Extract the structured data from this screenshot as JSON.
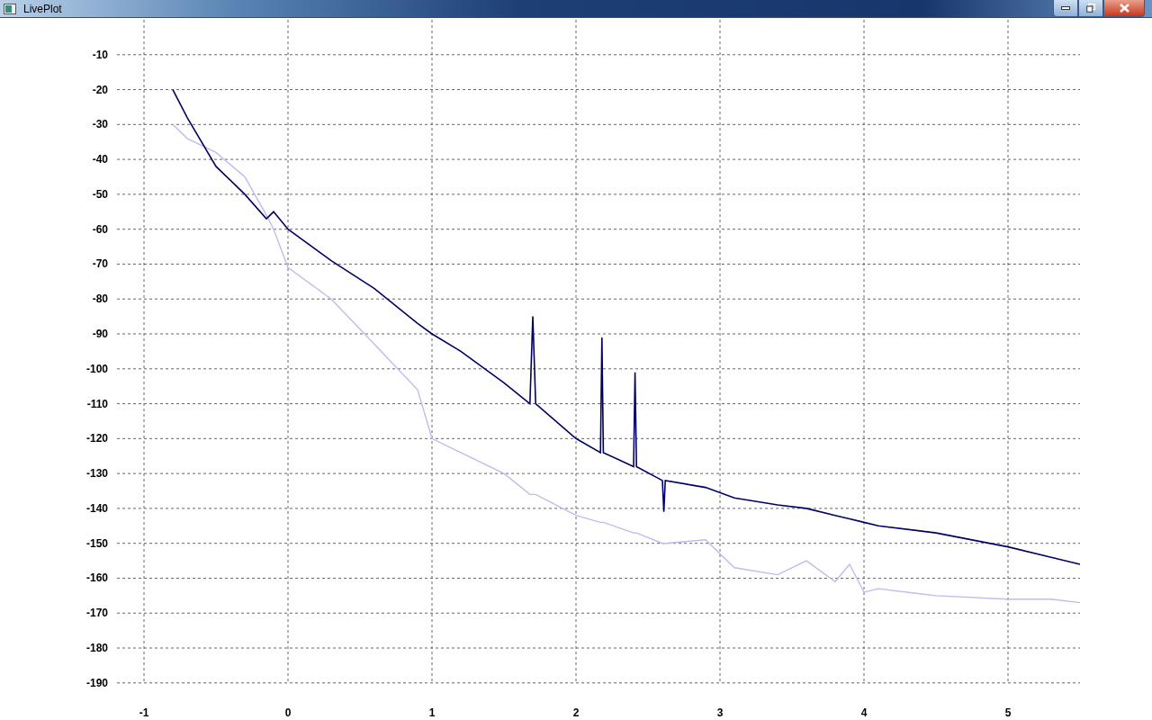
{
  "window": {
    "title": "LivePlot"
  },
  "plot": {
    "chart_data": {
      "type": "line",
      "x": [
        -0.8,
        -0.7,
        -0.5,
        -0.3,
        -0.15,
        -0.1,
        0,
        0.3,
        0.6,
        0.9,
        1.0,
        1.2,
        1.5,
        1.68,
        1.7,
        1.72,
        2.0,
        2.17,
        2.18,
        2.19,
        2.4,
        2.41,
        2.42,
        2.6,
        2.61,
        2.62,
        2.9,
        3.1,
        3.4,
        3.6,
        3.8,
        3.9,
        4.0,
        4.1,
        4.5,
        5.0,
        5.3,
        5.5
      ],
      "series": [
        {
          "color": "#000066",
          "values": [
            -20,
            -28,
            -42,
            -50,
            -57,
            -55,
            -60,
            -69,
            -77,
            -87,
            -90,
            -95,
            -104,
            -110,
            -85,
            -110,
            -120,
            -124,
            -91,
            -124,
            -128,
            -101,
            -128,
            -132,
            -141,
            -132,
            -134,
            -137,
            -139,
            -140,
            -142,
            -143,
            -144,
            -145,
            -147,
            -151,
            -154,
            -156
          ]
        },
        {
          "color": "#bcbcf0",
          "values": [
            -30,
            -34,
            -38,
            -45,
            -56,
            -60,
            -71,
            -80,
            -93,
            -106,
            -120,
            -124,
            -130,
            -136,
            -136,
            -136,
            -142,
            -144,
            -144,
            -144,
            -147,
            -147,
            -147,
            -150,
            -150,
            -150,
            -149,
            -157,
            -159,
            -155,
            -161,
            -156,
            -164,
            -163,
            -165,
            -166,
            -166,
            -167
          ]
        }
      ],
      "grid": true,
      "xlim": [
        -1.1875,
        5.5
      ],
      "ylim": [
        -190,
        0
      ],
      "xticks": [
        -1,
        0,
        1,
        2,
        3,
        4,
        5
      ],
      "yticks": [
        -10,
        -20,
        -30,
        -40,
        -50,
        -60,
        -70,
        -80,
        -90,
        -100,
        -110,
        -120,
        -130,
        -140,
        -150,
        -160,
        -170,
        -180,
        -190
      ]
    }
  }
}
